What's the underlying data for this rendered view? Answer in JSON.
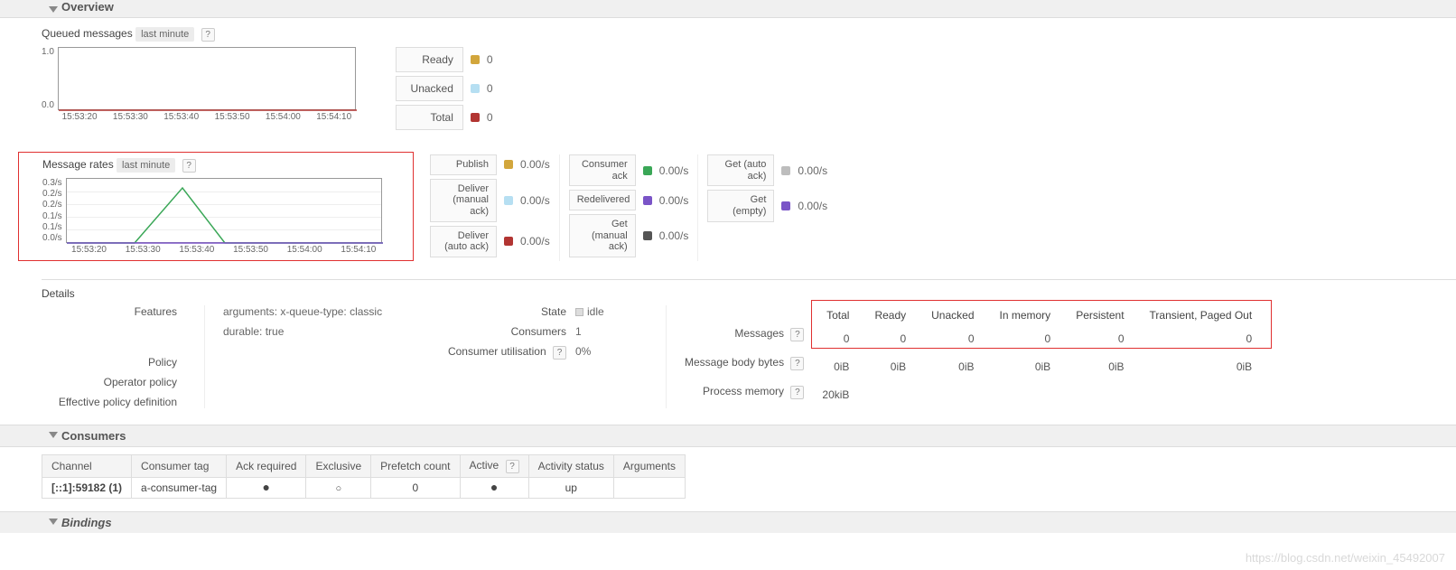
{
  "sections": {
    "overview": "Overview",
    "consumers": "Consumers",
    "bindings": "Bindings",
    "details": "Details"
  },
  "queued_msgs": {
    "title": "Queued messages",
    "period": "last minute"
  },
  "msg_rates": {
    "title": "Message rates",
    "period": "last minute"
  },
  "chart_data": [
    {
      "id": "queued",
      "type": "line",
      "x_ticks": [
        "15:53:20",
        "15:53:30",
        "15:53:40",
        "15:53:50",
        "15:54:00",
        "15:54:10"
      ],
      "y_ticks": [
        "1.0",
        "0.0"
      ],
      "ylim": [
        0,
        1
      ],
      "series": [
        {
          "name": "Ready",
          "color": "#d2a63c",
          "value": "0",
          "values": [
            0,
            0,
            0,
            0,
            0,
            0
          ]
        },
        {
          "name": "Unacked",
          "color": "#b6dff2",
          "value": "0",
          "values": [
            0,
            0,
            0,
            0,
            0,
            0
          ]
        },
        {
          "name": "Total",
          "color": "#b23532",
          "value": "0",
          "values": [
            0,
            0,
            0,
            0,
            0,
            0
          ]
        }
      ]
    },
    {
      "id": "rates",
      "type": "line",
      "x_ticks": [
        "15:53:20",
        "15:53:30",
        "15:53:40",
        "15:53:50",
        "15:54:00",
        "15:54:10"
      ],
      "y_ticks": [
        "0.3/s",
        "0.2/s",
        "0.2/s",
        "0.1/s",
        "0.1/s",
        "0.0/s"
      ],
      "ylim": [
        0,
        0.3
      ],
      "peak": {
        "series": "Publish",
        "approx_time": "15:53:33",
        "approx_value": 0.25
      },
      "series": [
        {
          "name": "Publish",
          "color": "#d2a63c",
          "value": "0.00/s"
        },
        {
          "name": "Deliver (manual ack)",
          "color": "#b6dff2",
          "value": "0.00/s"
        },
        {
          "name": "Deliver (auto ack)",
          "color": "#b23532",
          "value": "0.00/s"
        },
        {
          "name": "Consumer ack",
          "color": "#3aa757",
          "value": "0.00/s"
        },
        {
          "name": "Redelivered",
          "color": "#7a54c7",
          "value": "0.00/s"
        },
        {
          "name": "Get (manual ack)",
          "color": "#555555",
          "value": "0.00/s"
        },
        {
          "name": "Get (auto ack)",
          "color": "#bdbdbd",
          "value": "0.00/s"
        },
        {
          "name": "Get (empty)",
          "color": "#7a54c7",
          "value": "0.00/s"
        }
      ]
    }
  ],
  "details": {
    "features_label": "Features",
    "features_arguments": "arguments:",
    "features_arguments_val": "x-queue-type: classic",
    "features_durable": "durable:",
    "features_durable_val": "true",
    "policy_label": "Policy",
    "operator_policy_label": "Operator policy",
    "effective_policy_label": "Effective policy definition",
    "state_label": "State",
    "state_value": "idle",
    "consumers_label": "Consumers",
    "consumers_value": "1",
    "consumer_util_label": "Consumer utilisation",
    "consumer_util_value": "0%"
  },
  "stats": {
    "cols": [
      "Total",
      "Ready",
      "Unacked",
      "In memory",
      "Persistent",
      "Transient, Paged Out"
    ],
    "rows": [
      {
        "label": "Messages",
        "help": true,
        "cells": [
          "0",
          "0",
          "0",
          "0",
          "0",
          "0"
        ]
      },
      {
        "label": "Message body bytes",
        "help": true,
        "cells": [
          "0iB",
          "0iB",
          "0iB",
          "0iB",
          "0iB",
          "0iB"
        ]
      },
      {
        "label": "Process memory",
        "help": true,
        "cells": [
          "20kiB",
          "",
          "",
          "",
          "",
          ""
        ]
      }
    ]
  },
  "consumers_table": {
    "headers": [
      "Channel",
      "Consumer tag",
      "Ack required",
      "Exclusive",
      "Prefetch count",
      "Active",
      "Activity status",
      "Arguments"
    ],
    "row": {
      "channel": "[::1]:59182 (1)",
      "tag": "a-consumer-tag",
      "ack_required": "●",
      "exclusive": "○",
      "prefetch": "0",
      "active": "●",
      "activity_status": "up",
      "arguments": ""
    }
  },
  "watermark": "https://blog.csdn.net/weixin_45492007"
}
